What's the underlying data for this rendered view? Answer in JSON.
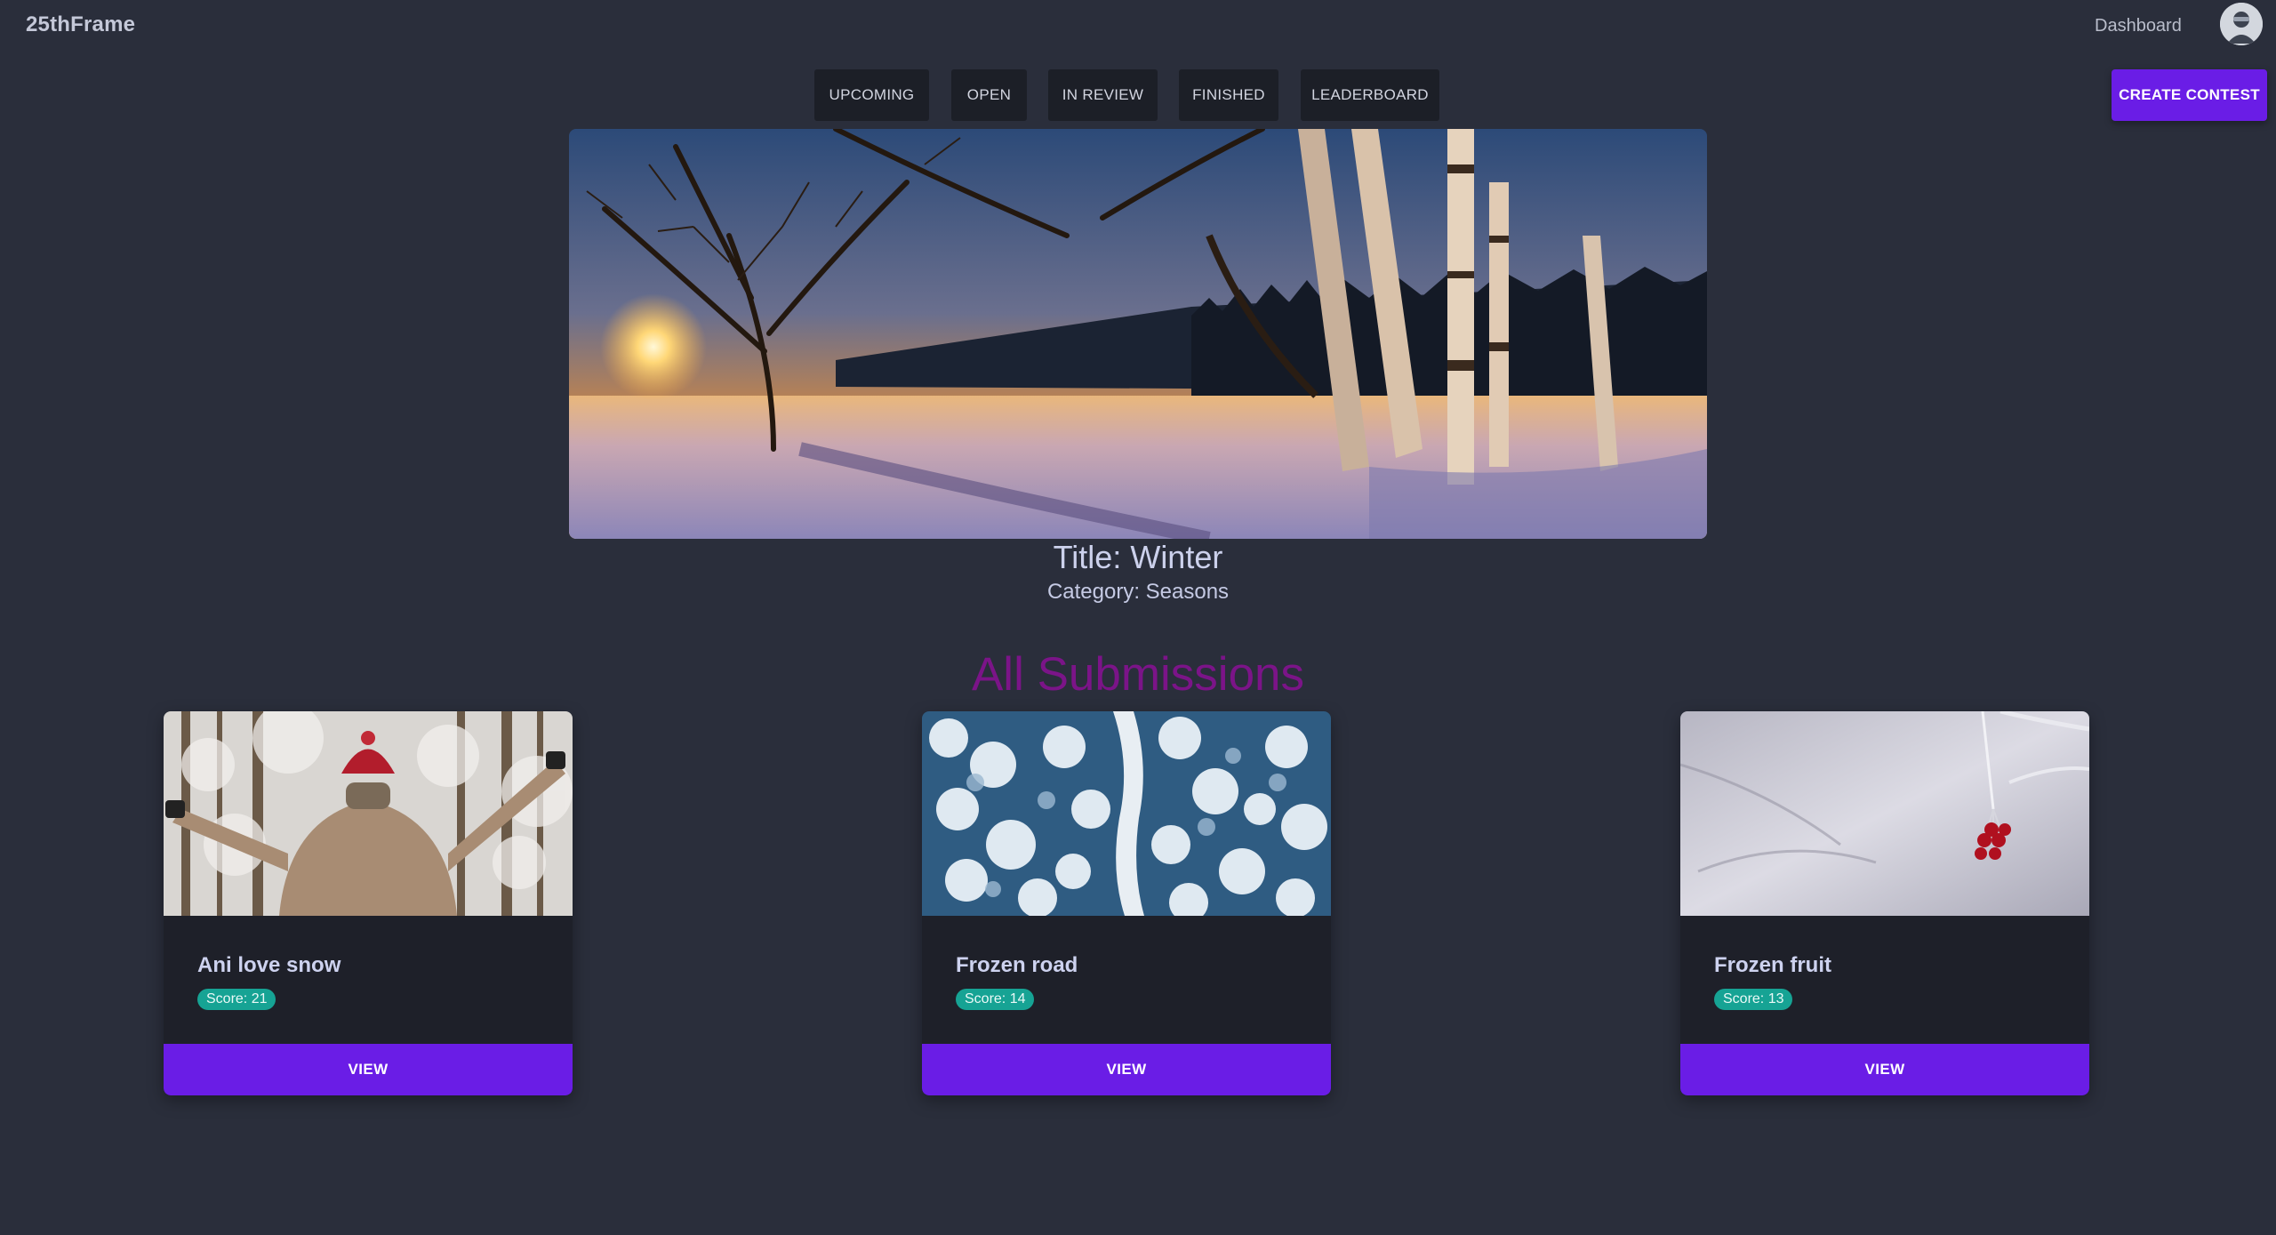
{
  "header": {
    "brand": "25thFrame",
    "dashboard_link": "Dashboard",
    "avatar_icon": "user-avatar-icon"
  },
  "nav": {
    "tabs": [
      {
        "label": "UPCOMING"
      },
      {
        "label": "OPEN"
      },
      {
        "label": "IN REVIEW"
      },
      {
        "label": "FINISHED"
      },
      {
        "label": "LEADERBOARD"
      }
    ],
    "create_contest": "CREATE CONTEST"
  },
  "contest": {
    "title": "Title: Winter",
    "category": "Category: Seasons",
    "hero_image": "winter-sunset-birch-trees"
  },
  "submissions": {
    "heading": "All Submissions",
    "items": [
      {
        "title": "Ani love snow",
        "score": "Score: 21",
        "image": "woman-red-hat-snowy-forest",
        "button": "VIEW"
      },
      {
        "title": "Frozen road",
        "score": "Score: 14",
        "image": "aerial-snowy-forest-road",
        "button": "VIEW"
      },
      {
        "title": "Frozen fruit",
        "score": "Score: 13",
        "image": "frozen-red-berries",
        "button": "VIEW"
      }
    ]
  },
  "colors": {
    "background": "#2a2e3b",
    "accent": "#6a1de6",
    "heading_purple": "#7b1488",
    "score_badge": "#16a394",
    "tab_bg": "#1c1f27",
    "card_bg": "#1e2029"
  }
}
